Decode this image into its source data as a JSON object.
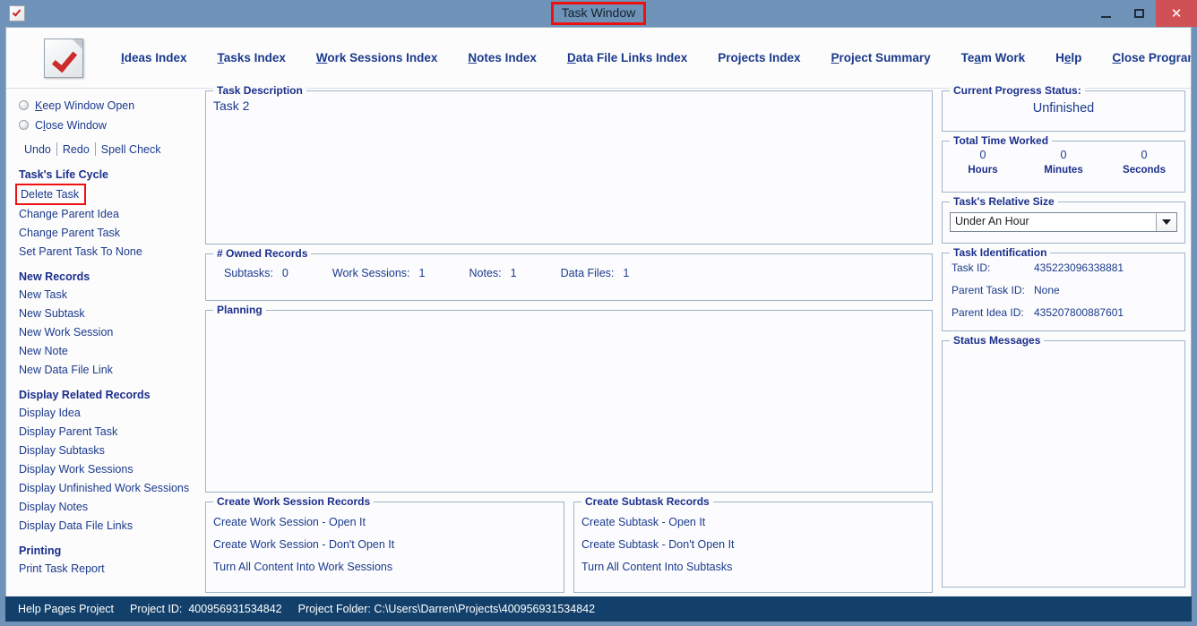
{
  "window": {
    "title": "Task Window",
    "icon": "checked-document-icon",
    "controls": {
      "minimize": "",
      "maximize": "",
      "close": "✕"
    },
    "title_highlight_color": "#ee1111",
    "titlebar_color": "#6f93b8"
  },
  "menubar": {
    "logo": "checked-document-logo",
    "items": [
      {
        "label": "Ideas Index",
        "accel": "I"
      },
      {
        "label": "Tasks Index",
        "accel": "T"
      },
      {
        "label": "Work Sessions Index",
        "accel": "W"
      },
      {
        "label": "Notes Index",
        "accel": "N"
      },
      {
        "label": "Data File Links Index",
        "accel": "D"
      },
      {
        "label": "Projects Index",
        "accel": ""
      },
      {
        "label": "Project Summary",
        "accel": "P"
      },
      {
        "label": "Team Work",
        "accel": "a"
      },
      {
        "label": "Help",
        "accel": "e"
      },
      {
        "label": "Close Program",
        "accel": "C"
      }
    ]
  },
  "sidebar": {
    "radios": [
      {
        "label": "Keep Window Open",
        "accel": "K",
        "selected": false
      },
      {
        "label": "Close Window",
        "accel": "l",
        "selected": false
      }
    ],
    "edit_commands": [
      "Undo",
      "Redo",
      "Spell Check"
    ],
    "groups": [
      {
        "heading": "Task's Life Cycle",
        "items": [
          {
            "label": "Delete Task",
            "highlighted": true
          },
          {
            "label": "Change Parent Idea",
            "highlighted": false
          },
          {
            "label": "Change Parent Task",
            "highlighted": false
          },
          {
            "label": "Set Parent Task To None",
            "highlighted": false
          }
        ]
      },
      {
        "heading": "New Records",
        "items": [
          {
            "label": "New Task",
            "highlighted": false
          },
          {
            "label": "New Subtask",
            "highlighted": false
          },
          {
            "label": "New Work Session",
            "highlighted": false
          },
          {
            "label": "New Note",
            "highlighted": false
          },
          {
            "label": "New Data File Link",
            "highlighted": false
          }
        ]
      },
      {
        "heading": "Display Related Records",
        "items": [
          {
            "label": "Display Idea",
            "highlighted": false
          },
          {
            "label": "Display Parent Task",
            "highlighted": false
          },
          {
            "label": "Display Subtasks",
            "highlighted": false
          },
          {
            "label": "Display Work Sessions",
            "highlighted": false
          },
          {
            "label": "Display Unfinished Work Sessions",
            "highlighted": false
          },
          {
            "label": "Display Notes",
            "highlighted": false
          },
          {
            "label": "Display Data File Links",
            "highlighted": false
          }
        ]
      },
      {
        "heading": "Printing",
        "items": [
          {
            "label": "Print Task Report",
            "highlighted": false
          }
        ]
      }
    ]
  },
  "main": {
    "task_description": {
      "legend": "Task Description",
      "value": "Task 2"
    },
    "owned_records": {
      "legend": "# Owned Records",
      "fields": [
        {
          "label": "Subtasks:",
          "value": "0"
        },
        {
          "label": "Work Sessions:",
          "value": "1"
        },
        {
          "label": "Notes:",
          "value": "1"
        },
        {
          "label": "Data Files:",
          "value": "1"
        }
      ]
    },
    "planning": {
      "legend": "Planning",
      "value": ""
    },
    "create_work_session": {
      "legend": "Create Work Session Records",
      "actions": [
        "Create Work Session - Open It",
        "Create Work Session - Don't Open It",
        "Turn All Content Into Work Sessions"
      ]
    },
    "create_subtask": {
      "legend": "Create Subtask Records",
      "actions": [
        "Create Subtask - Open It",
        "Create Subtask - Don't Open It",
        "Turn All Content Into Subtasks"
      ]
    }
  },
  "right": {
    "progress": {
      "legend": "Current Progress Status:",
      "value": "Unfinished"
    },
    "time_worked": {
      "legend": "Total Time Worked",
      "cells": [
        {
          "value": "0",
          "unit": "Hours"
        },
        {
          "value": "0",
          "unit": "Minutes"
        },
        {
          "value": "0",
          "unit": "Seconds"
        }
      ]
    },
    "relative_size": {
      "legend": "Task's Relative Size",
      "selected": "Under An Hour"
    },
    "task_identification": {
      "legend": "Task Identification",
      "rows": [
        {
          "label": "Task ID:",
          "value": "435223096338881"
        },
        {
          "label": "Parent Task ID:",
          "value": "None"
        },
        {
          "label": "Parent Idea ID:",
          "value": "435207800887601"
        }
      ]
    },
    "status_messages": {
      "legend": "Status Messages",
      "value": ""
    }
  },
  "statusbar": {
    "project_name": "Help Pages Project",
    "project_id_label": "Project ID:",
    "project_id": "400956931534842",
    "project_folder_label": "Project Folder:",
    "project_folder": "C:\\Users\\Darren\\Projects\\400956931534842"
  }
}
